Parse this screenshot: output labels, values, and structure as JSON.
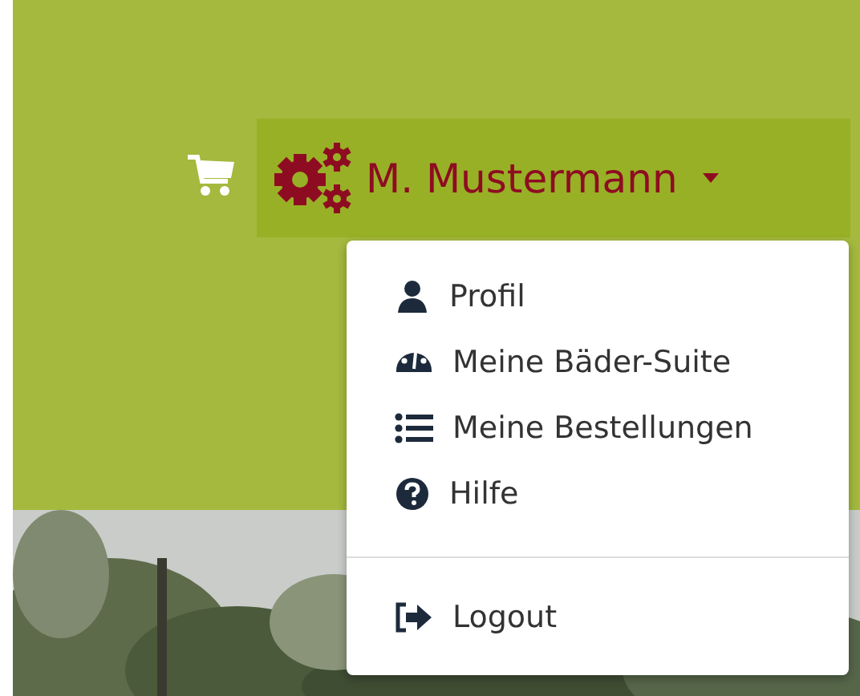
{
  "user_menu": {
    "name": "M. Mustermann",
    "expanded": true
  },
  "menu_items": [
    {
      "label": "Profil"
    },
    {
      "label": "Meine Bäder-Suite"
    },
    {
      "label": "Meine Bestellungen"
    },
    {
      "label": "Hilfe"
    }
  ],
  "logout": {
    "label": "Logout"
  }
}
